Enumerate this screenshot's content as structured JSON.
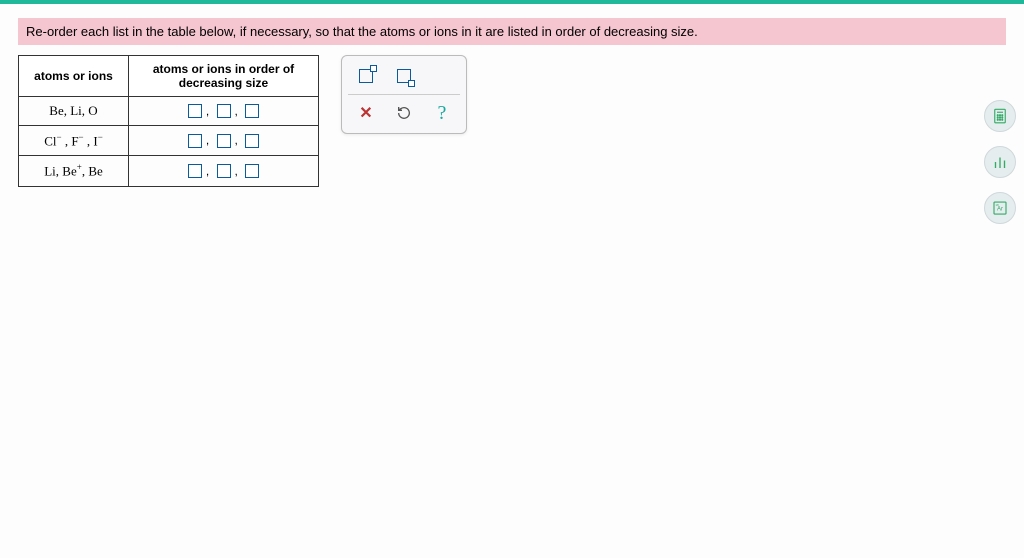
{
  "instruction": "Re-order each list in the table below, if necessary, so that the atoms or ions in it are listed in order of decreasing size.",
  "table": {
    "header1": "atoms or ions",
    "header2": "atoms or ions in order of decreasing size",
    "rows": [
      {
        "label": "Be, Li, O"
      },
      {
        "label": "Cl⁻ , F⁻ , I⁻"
      },
      {
        "label": "Li, Be⁺, Be"
      }
    ]
  },
  "tools": {
    "superscript": "superscript",
    "subscript": "subscript",
    "clear": "clear",
    "reset": "reset",
    "help": "help",
    "calculator": "calculator",
    "graph": "graph",
    "periodic": "Ar"
  }
}
